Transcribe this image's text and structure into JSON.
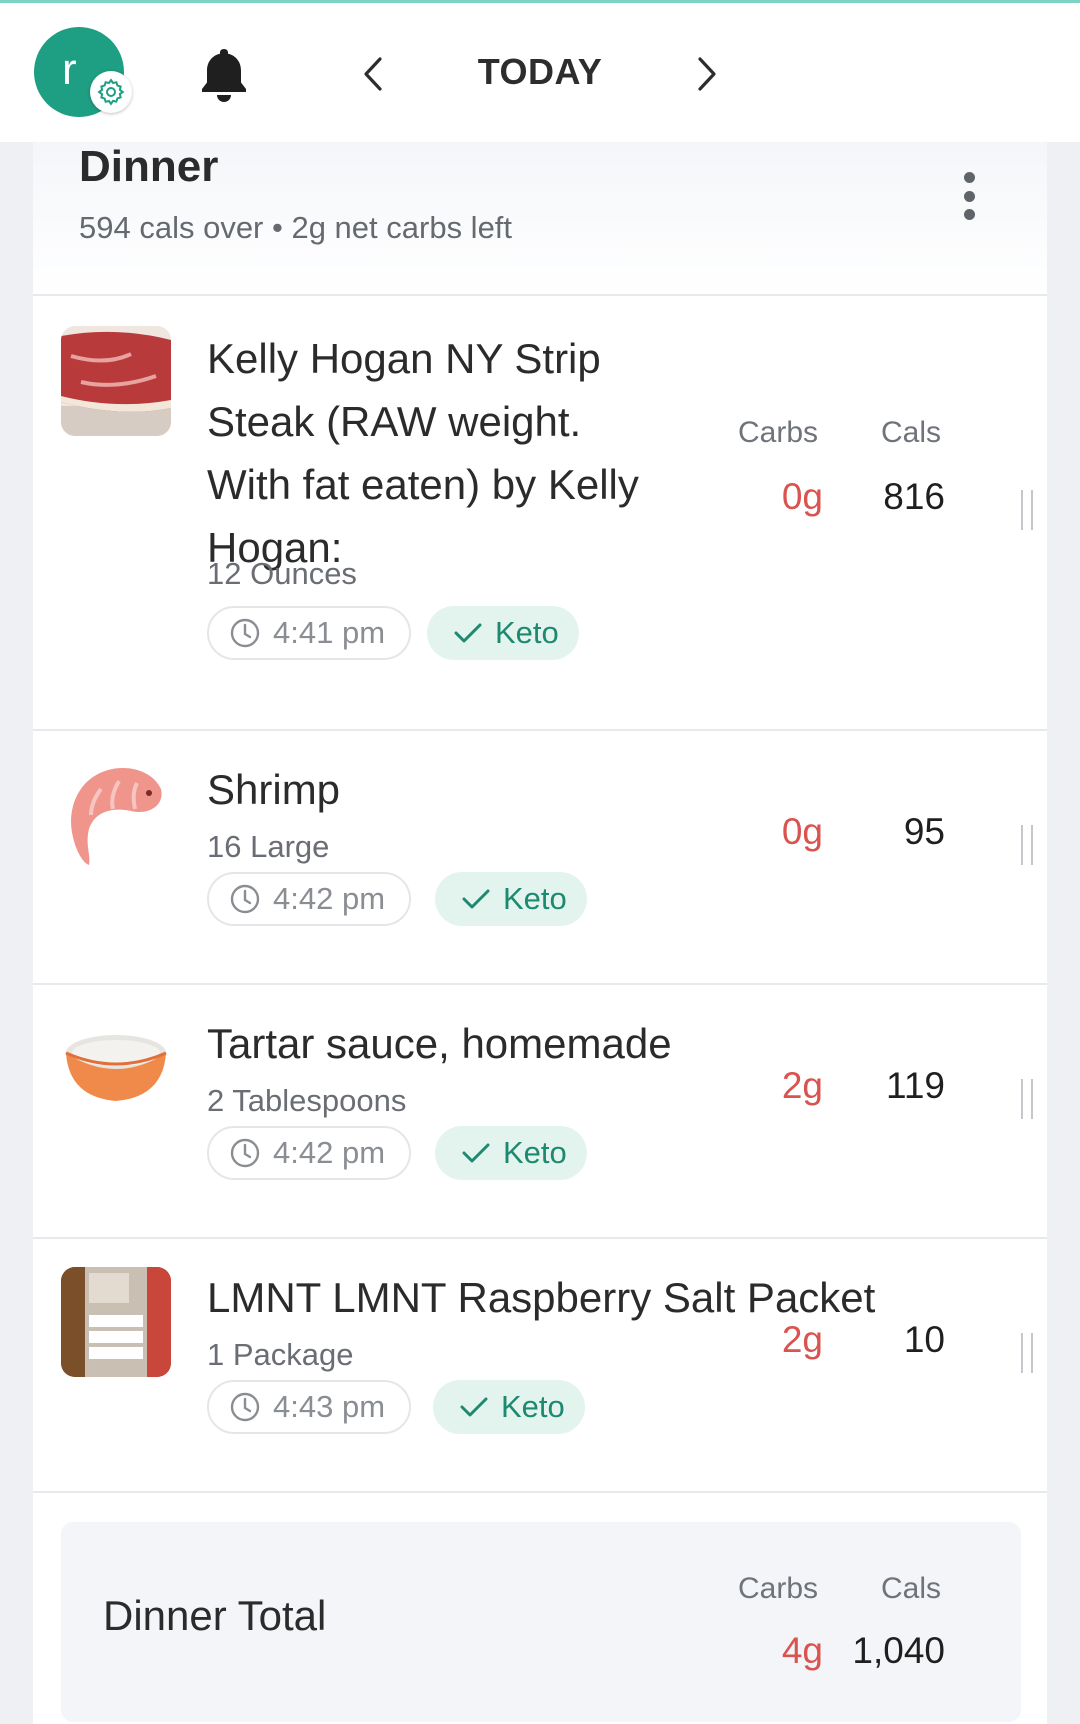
{
  "header": {
    "avatar_letter": "r",
    "date_label": "TODAY"
  },
  "meal": {
    "title": "Dinner",
    "subtitle": "594 cals over • 2g net carbs left",
    "col_carbs": "Carbs",
    "col_cals": "Cals",
    "items": [
      {
        "name_lines": [
          "Kelly Hogan NY Strip",
          "Steak (RAW weight.",
          "With fat eaten) by Kelly",
          "Hogan:"
        ],
        "serving": "12 Ounces",
        "time": "4:41 pm",
        "tag": "Keto",
        "carbs": "0g",
        "cals": "816"
      },
      {
        "name": "Shrimp",
        "serving": "16 Large",
        "time": "4:42 pm",
        "tag": "Keto",
        "carbs": "0g",
        "cals": "95"
      },
      {
        "name": "Tartar sauce, homemade",
        "serving": "2 Tablespoons",
        "time": "4:42 pm",
        "tag": "Keto",
        "carbs": "2g",
        "cals": "119"
      },
      {
        "name": "LMNT LMNT Raspberry Salt Packet",
        "serving": "1 Package",
        "time": "4:43 pm",
        "tag": "Keto",
        "carbs": "2g",
        "cals": "10"
      }
    ],
    "total": {
      "label": "Dinner Total",
      "col_carbs": "Carbs",
      "col_cals": "Cals",
      "carbs": "4g",
      "cals": "1,040"
    }
  },
  "icons": {
    "settings": "gear-icon",
    "notifications": "bell-icon",
    "prev": "chevron-left-icon",
    "next": "chevron-right-icon",
    "more": "kebab-menu-icon",
    "time": "clock-icon",
    "tag": "check-icon",
    "reorder": "drag-handle-icon"
  },
  "colors": {
    "accent": "#1e9e82",
    "carbs": "#d9534f",
    "keto_bg": "#e3f4ef",
    "keto_text": "#1d8a70"
  }
}
